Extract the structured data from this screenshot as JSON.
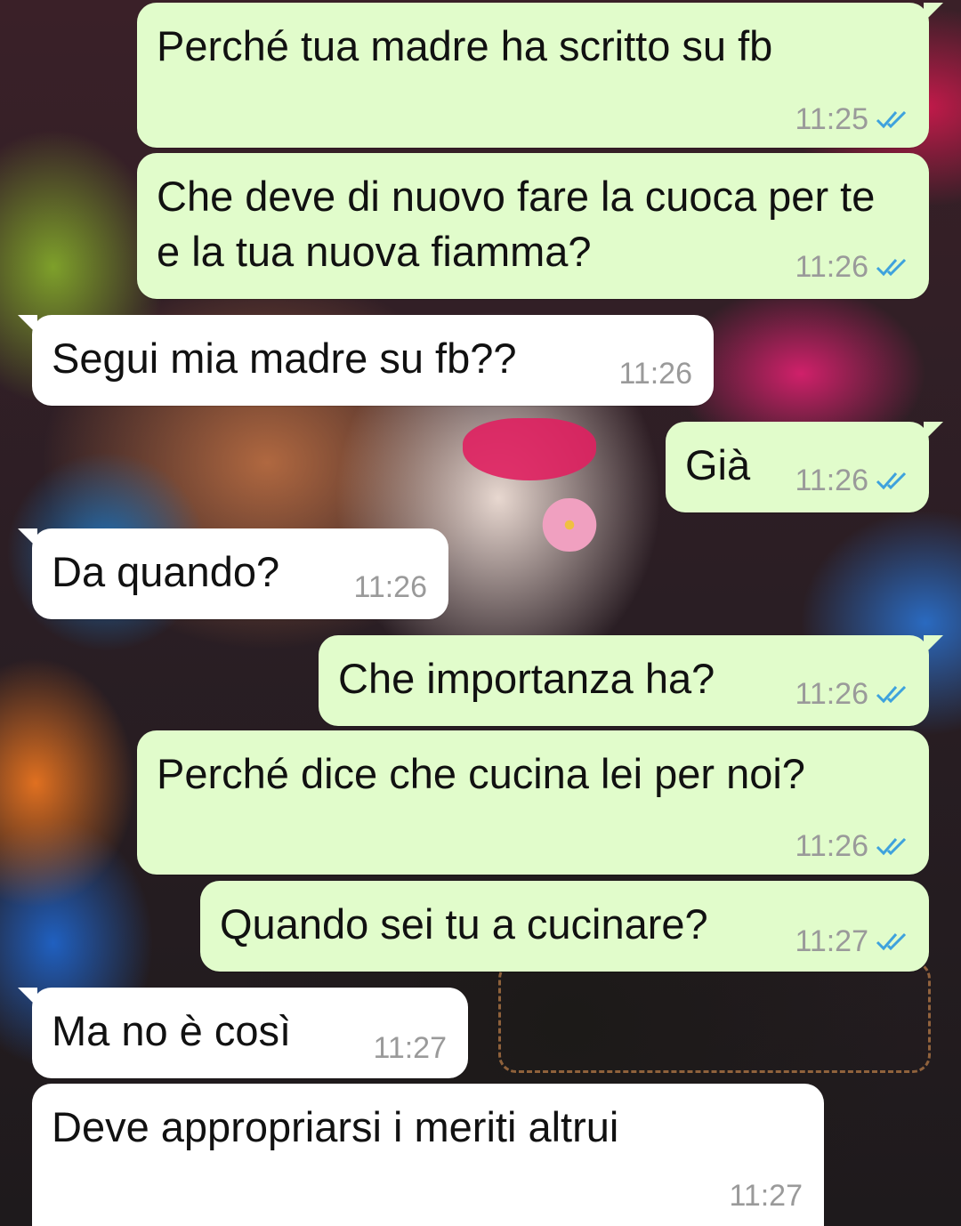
{
  "theme": {
    "outgoing_bubble": "#e1fccb",
    "incoming_bubble": "#ffffff",
    "tick_color": "#3ea2dd",
    "time_color": "#9a9a9a"
  },
  "messages": [
    {
      "direction": "out",
      "text": "Perché tua madre ha scritto su fb",
      "time": "11:25",
      "status": "read-double-check-icon"
    },
    {
      "direction": "out",
      "text": "Che deve di nuovo fare la cuoca per te e la tua nuova fiamma?",
      "time": "11:26",
      "status": "read-double-check-icon"
    },
    {
      "direction": "in",
      "text": "Segui mia madre su fb??",
      "time": "11:26"
    },
    {
      "direction": "out",
      "text": "Già",
      "time": "11:26",
      "status": "read-double-check-icon"
    },
    {
      "direction": "in",
      "text": "Da quando?",
      "time": "11:26"
    },
    {
      "direction": "out",
      "text": "Che importanza ha?",
      "time": "11:26",
      "status": "read-double-check-icon"
    },
    {
      "direction": "out",
      "text": "Perché dice che cucina lei per noi?",
      "time": "11:26",
      "status": "read-double-check-icon"
    },
    {
      "direction": "out",
      "text": "Quando sei tu a cucinare?",
      "time": "11:27",
      "status": "read-double-check-icon"
    },
    {
      "direction": "in",
      "text": "Ma no è così",
      "time": "11:27"
    },
    {
      "direction": "in",
      "text": "Deve appropriarsi i meriti altrui",
      "time": "11:27"
    }
  ]
}
